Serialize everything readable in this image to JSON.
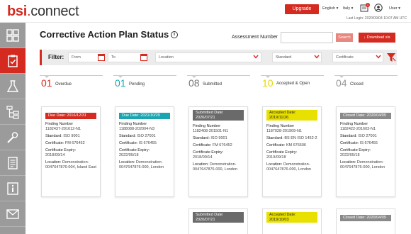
{
  "app": {
    "logo_bsi": "bsi",
    "logo_dot": ".",
    "logo_connect": "connect"
  },
  "topbar": {
    "upgrade_label": "Upgrade",
    "language": "English ▾",
    "region": "Italy ▾",
    "notifications_count": "1",
    "user": "User ▾",
    "last_login": "Last Login: 2020/09/04 10:07 AM UTC"
  },
  "page": {
    "title": "Corrective Action Plan Status",
    "info_icon": "i"
  },
  "assessment": {
    "label": "Assessment Number",
    "value": "",
    "search_label": "Search",
    "download_label": "↓ Download xls"
  },
  "filter": {
    "label": "Filter:",
    "from_placeholder": "From",
    "to_placeholder": "To",
    "location_placeholder": "Location",
    "standard_placeholder": "Standard",
    "certificate_placeholder": "Certificate"
  },
  "sidebar": {
    "items": [
      {
        "icon": "dashboard-icon"
      },
      {
        "icon": "clipboard-icon"
      },
      {
        "icon": "flask-icon"
      },
      {
        "icon": "org-chart-icon"
      },
      {
        "icon": "tools-icon"
      },
      {
        "icon": "document-icon"
      },
      {
        "icon": "info-icon"
      },
      {
        "icon": "mail-icon"
      }
    ]
  },
  "columns": [
    {
      "count": "01",
      "status": "Overdue",
      "color": "#d42a20",
      "card": {
        "chip": "Due Date: 2016/12/31",
        "chip_bg": "#d42a20",
        "chip_fg": "#ffffff",
        "finding_label": "Finding Number",
        "finding": "1182437-201612-N1",
        "standard_label": "Standard:",
        "standard": "ISO 9001",
        "certificate_label": "Certificate:",
        "certificate": "FM 676452",
        "expiry_label": "Certificate Expiry:",
        "expiry": "2018/09/14",
        "location_label": "Location:",
        "location": "Demonstration-0047647876-004, Island East"
      }
    },
    {
      "count": "01",
      "status": "Pending",
      "color": "#1aa6b0",
      "card": {
        "chip": "Due Date: 2021/10/29",
        "chip_bg": "#1aa6b0",
        "chip_fg": "#ffffff",
        "finding_label": "Finding Number",
        "finding": "1188088-202004-N3",
        "standard_label": "Standard:",
        "standard": "ISO 27001",
        "certificate_label": "Certificate:",
        "certificate": "IS 676455",
        "expiry_label": "Certificate Expiry:",
        "expiry": "2022/05/18",
        "location_label": "Location:",
        "location": "Demonstration-0047647876-000, London"
      }
    },
    {
      "count": "08",
      "status": "Submitted",
      "color": "#777777",
      "card": {
        "chip": "Submitted Date: 2020/07/21",
        "chip_bg": "#6a6a6a",
        "chip_fg": "#ffffff",
        "finding_label": "Finding Number",
        "finding": "1182408-201501-N1",
        "standard_label": "Standard:",
        "standard": "ISO 9001",
        "certificate_label": "Certificate:",
        "certificate": "FM 676452",
        "expiry_label": "Certificate Expiry:",
        "expiry": "2018/09/14",
        "location_label": "Location:",
        "location": "Demonstration-0047647876-000, London"
      },
      "card2_chip": "Submitted Date: 2020/07/21"
    },
    {
      "count": "10",
      "status": "Accepted & Open",
      "color": "#e8d600",
      "card": {
        "chip": "Accepted Date: 2019/11/26",
        "chip_bg": "#e8e000",
        "chip_fg": "#222222",
        "finding_label": "Finding Number",
        "finding": "1187028-201909-N1",
        "standard_label": "Standard:",
        "standard": "BS EN ISO 1452-2",
        "certificate_label": "Certificate:",
        "certificate": "KM 676606",
        "expiry_label": "Certificate Expiry:",
        "expiry": "2019/09/18",
        "location_label": "Location:",
        "location": "Demonstration-0047647876-000, London"
      },
      "card2_chip": "Accepted Date: 2019/10/03"
    },
    {
      "count": "04",
      "status": "Closed",
      "color": "#999999",
      "card": {
        "chip": "Closed Date: 2020/04/09",
        "chip_bg": "#8a8a8a",
        "chip_fg": "#ffffff",
        "finding_label": "Finding Number",
        "finding": "1182422-201603-N1",
        "standard_label": "Standard:",
        "standard": "ISO 27001",
        "certificate_label": "Certificate:",
        "certificate": "IS 676455",
        "expiry_label": "Certificate Expiry:",
        "expiry": "2022/05/18",
        "location_label": "Location:",
        "location": "Demonstration-0047647876-000, London"
      },
      "card2_chip": "Closed Date: 2020/04/09"
    }
  ]
}
